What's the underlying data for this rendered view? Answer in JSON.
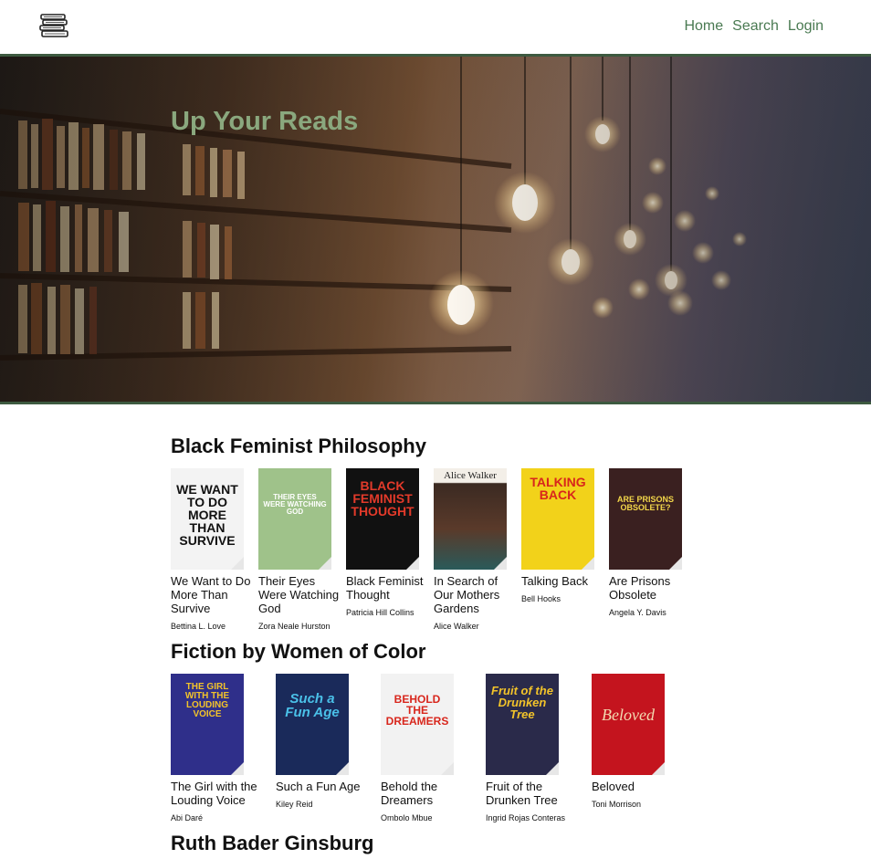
{
  "nav": {
    "links": [
      "Home",
      "Search",
      "Login"
    ]
  },
  "hero": {
    "title": "Up Your Reads"
  },
  "sections": [
    {
      "title": "Black Feminist Philosophy",
      "books": [
        {
          "title": "We Want to Do More Than Survive",
          "author": "Bettina L. Love",
          "cover_text": "WE WANT TO DO MORE THAN SURVIVE",
          "cover_bg": "#f3f3f3",
          "cover_fg": "#111111"
        },
        {
          "title": "Their Eyes Were Watching God",
          "author": "Zora Neale Hurston",
          "cover_text": "THEIR EYES WERE WATCHING GOD",
          "cover_bg": "#9fc28a",
          "cover_fg": "#ffffff"
        },
        {
          "title": "Black Feminist Thought",
          "author": "Patricia Hill Collins",
          "cover_text": "BLACK FEMINIST THOUGHT",
          "cover_bg": "#111111",
          "cover_fg": "#e23a2a"
        },
        {
          "title": "In Search of Our Mothers Gardens",
          "author": "Alice Walker",
          "cover_text": "Alice Walker",
          "cover_bg": "#3b2a22",
          "cover_fg": "#ffffff"
        },
        {
          "title": "Talking Back",
          "author": "Bell Hooks",
          "cover_text": "TALKING BACK",
          "cover_bg": "#f2d21a",
          "cover_fg": "#d8261c"
        },
        {
          "title": "Are Prisons Obsolete",
          "author": "Angela Y. Davis",
          "cover_text": "ARE PRISONS OBSOLETE?",
          "cover_bg": "#3a2020",
          "cover_fg": "#f3d74a"
        }
      ]
    },
    {
      "title": "Fiction by Women of Color",
      "books": [
        {
          "title": "The Girl with the Louding Voice",
          "author": "Abi Daré",
          "cover_text": "THE GIRL WITH THE LOUDING VOICE",
          "cover_bg": "#2f2f8a",
          "cover_fg": "#f2c32a"
        },
        {
          "title": "Such a Fun Age",
          "author": "Kiley Reid",
          "cover_text": "Such a Fun Age",
          "cover_bg": "#1a2a5a",
          "cover_fg": "#4ac0e8"
        },
        {
          "title": "Behold the Dreamers",
          "author": "Ombolo Mbue",
          "cover_text": "BEHOLD THE DREAMERS",
          "cover_bg": "#f2f2f2",
          "cover_fg": "#d8261c"
        },
        {
          "title": "Fruit of the Drunken Tree",
          "author": "Ingrid Rojas Conteras",
          "cover_text": "Fruit of the Drunken Tree",
          "cover_bg": "#2a2a4a",
          "cover_fg": "#f2c32a"
        },
        {
          "title": "Beloved",
          "author": "Toni Morrison",
          "cover_text": "Beloved",
          "cover_bg": "#c4141e",
          "cover_fg": "#f3d9b0"
        }
      ]
    },
    {
      "title": "Ruth Bader Ginsburg",
      "books": []
    }
  ]
}
